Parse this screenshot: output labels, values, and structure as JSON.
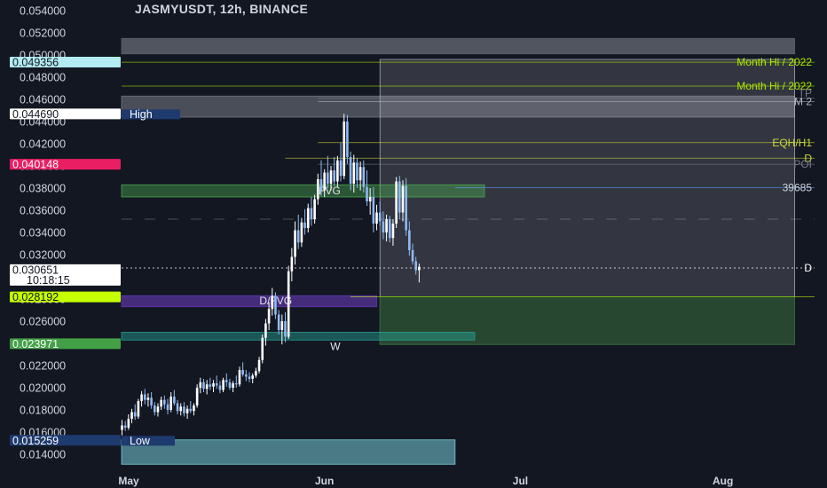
{
  "chart_data": {
    "type": "candlestick",
    "title": "JASMYUSDT, 12h, BINANCE",
    "ylim": [
      0.0125,
      0.0555
    ],
    "y_ticks": [
      "0.054000",
      "0.052000",
      "0.050000",
      "0.048000",
      "0.046000",
      "0.044000",
      "0.042000",
      "0.040000",
      "0.038000",
      "0.036000",
      "0.034000",
      "0.032000",
      "0.030000",
      "0.028000",
      "0.026000",
      "0.024000",
      "0.022000",
      "0.020000",
      "0.018000",
      "0.016000",
      "0.014000"
    ],
    "x_ticks": [
      {
        "label": "May",
        "index": 0
      },
      {
        "label": "Jun",
        "index": 62
      },
      {
        "label": "Jul",
        "index": 122
      },
      {
        "label": "Aug",
        "index": 184
      }
    ],
    "price_tags": [
      {
        "value": 0.049356,
        "text": "0.049356",
        "bg": "#b2ebf2",
        "fg": "#131722"
      },
      {
        "value": 0.04469,
        "text": "0.044690",
        "bg": "#ffffff",
        "fg": "#131722",
        "side_text": "High",
        "side_bg": "#1e3a6e"
      },
      {
        "value": 0.040148,
        "text": "0.040148",
        "bg": "#e91e63",
        "fg": "#ffffff"
      },
      {
        "value": 0.030651,
        "text": "0.030651",
        "sub": "10:18:15",
        "bg": "#ffffff",
        "fg": "#131722"
      },
      {
        "value": 0.028192,
        "text": "0.028192",
        "bg": "#c6ff00",
        "fg": "#131722"
      },
      {
        "value": 0.023971,
        "text": "0.023971",
        "bg": "#43a047",
        "fg": "#ffffff"
      },
      {
        "value": 0.015259,
        "text": "0.015259",
        "bg": "#1e3a6e",
        "fg": "#ffffff",
        "side_text": "Low",
        "side_bg": "#1e3a6e"
      }
    ],
    "levels": [
      {
        "value": 0.04935,
        "from": 0,
        "text": "Month Hi / 2022",
        "color": "#aeea00"
      },
      {
        "value": 0.0472,
        "from": 0,
        "text": "Month Hi / 2022",
        "color": "#aeea00"
      },
      {
        "value": 0.0461,
        "from": 60,
        "text": "TP",
        "color": "#787b86"
      },
      {
        "value": 0.0458,
        "from": 60,
        "text": "M 2",
        "color": "#b2b5be"
      },
      {
        "value": 0.0421,
        "from": 60,
        "text": "EQH/H1",
        "color": "#cddc39"
      },
      {
        "value": 0.0407,
        "from": 50,
        "text": "D",
        "color": "#cddc39"
      },
      {
        "value": 0.04015,
        "from": 60,
        "text": "POI",
        "color": "#787b86"
      },
      {
        "value": 0.03805,
        "from": 102,
        "text": "39685",
        "color": "#5b9cf6"
      },
      {
        "value": 0.0308,
        "from": 0,
        "text": "D",
        "color": "#ffffff"
      },
      {
        "value": 0.0282,
        "from": 70,
        "text": "",
        "color": "#c6ff00"
      }
    ],
    "zones": [
      {
        "top": 0.0515,
        "bottom": 0.0501,
        "from": 0,
        "to": 206,
        "color": "#5d606b",
        "opacity": 0.85,
        "text": ""
      },
      {
        "top": 0.0463,
        "bottom": 0.0444,
        "from": 0,
        "to": 206,
        "color": "#787b86",
        "opacity": 0.55,
        "text": ""
      },
      {
        "top": 0.0496,
        "bottom": 0.0239,
        "from": 79,
        "to": 206,
        "color": "#b2b5be",
        "opacity": 0.2,
        "text": ""
      },
      {
        "top": 0.0282,
        "bottom": 0.0239,
        "from": 79,
        "to": 206,
        "color": "#1b5e20",
        "opacity": 0.45,
        "text": ""
      },
      {
        "top": 0.0383,
        "bottom": 0.0372,
        "from": 0,
        "to": 111,
        "color": "#4caf50",
        "opacity": 0.42,
        "text": "FVG"
      },
      {
        "top": 0.0283,
        "bottom": 0.0273,
        "from": 0,
        "to": 78,
        "color": "#673ab7",
        "opacity": 0.6,
        "text": "D/FVG"
      },
      {
        "top": 0.025,
        "bottom": 0.0243,
        "from": 0,
        "to": 108,
        "color": "#26a69a",
        "opacity": 0.45,
        "text": "W"
      },
      {
        "top": 0.0153,
        "bottom": 0.0131,
        "from": 0,
        "to": 102,
        "color": "#80deea",
        "opacity": 0.5,
        "text": ""
      }
    ],
    "candles": [
      [
        0.0162,
        0.0171,
        0.0157,
        0.0166
      ],
      [
        0.0166,
        0.017,
        0.0161,
        0.0164
      ],
      [
        0.0164,
        0.0176,
        0.0162,
        0.0172
      ],
      [
        0.0172,
        0.0181,
        0.0168,
        0.0178
      ],
      [
        0.0178,
        0.0185,
        0.0171,
        0.0174
      ],
      [
        0.0174,
        0.019,
        0.0172,
        0.0188
      ],
      [
        0.0188,
        0.0197,
        0.0183,
        0.0194
      ],
      [
        0.0194,
        0.0199,
        0.0185,
        0.0189
      ],
      [
        0.0189,
        0.0195,
        0.0183,
        0.0191
      ],
      [
        0.0191,
        0.0196,
        0.0181,
        0.0184
      ],
      [
        0.0184,
        0.0187,
        0.0175,
        0.0178
      ],
      [
        0.0178,
        0.0186,
        0.0174,
        0.0183
      ],
      [
        0.0183,
        0.0192,
        0.018,
        0.0189
      ],
      [
        0.0189,
        0.0193,
        0.0181,
        0.0185
      ],
      [
        0.0185,
        0.019,
        0.0176,
        0.018
      ],
      [
        0.018,
        0.0196,
        0.0178,
        0.0192
      ],
      [
        0.0192,
        0.0198,
        0.0184,
        0.0186
      ],
      [
        0.0186,
        0.0189,
        0.0176,
        0.0179
      ],
      [
        0.0179,
        0.0186,
        0.0175,
        0.0183
      ],
      [
        0.0183,
        0.0187,
        0.0174,
        0.0177
      ],
      [
        0.0177,
        0.0184,
        0.0172,
        0.0181
      ],
      [
        0.0181,
        0.0188,
        0.0177,
        0.0179
      ],
      [
        0.0179,
        0.0186,
        0.0175,
        0.0184
      ],
      [
        0.0184,
        0.0203,
        0.0182,
        0.02
      ],
      [
        0.02,
        0.0209,
        0.0195,
        0.0205
      ],
      [
        0.0205,
        0.0208,
        0.0196,
        0.0199
      ],
      [
        0.0199,
        0.0207,
        0.0194,
        0.0203
      ],
      [
        0.0203,
        0.0209,
        0.0198,
        0.0201
      ],
      [
        0.0201,
        0.0207,
        0.0196,
        0.0204
      ],
      [
        0.0204,
        0.0211,
        0.0199,
        0.0202
      ],
      [
        0.0202,
        0.0206,
        0.0195,
        0.0198
      ],
      [
        0.0198,
        0.0209,
        0.0196,
        0.0207
      ],
      [
        0.0207,
        0.0213,
        0.0201,
        0.0205
      ],
      [
        0.0205,
        0.0208,
        0.0198,
        0.02
      ],
      [
        0.02,
        0.0206,
        0.0196,
        0.0204
      ],
      [
        0.0204,
        0.0211,
        0.02,
        0.0203
      ],
      [
        0.0203,
        0.0219,
        0.0201,
        0.0216
      ],
      [
        0.0216,
        0.0223,
        0.021,
        0.0212
      ],
      [
        0.0212,
        0.0216,
        0.0206,
        0.021
      ],
      [
        0.021,
        0.0214,
        0.0205,
        0.0208
      ],
      [
        0.0208,
        0.0213,
        0.0204,
        0.0211
      ],
      [
        0.0211,
        0.0218,
        0.0209,
        0.0215
      ],
      [
        0.0215,
        0.0228,
        0.0213,
        0.0225
      ],
      [
        0.0225,
        0.0248,
        0.0222,
        0.0245
      ],
      [
        0.0245,
        0.0262,
        0.0238,
        0.0258
      ],
      [
        0.0258,
        0.0277,
        0.0252,
        0.0271
      ],
      [
        0.0271,
        0.029,
        0.0265,
        0.0283
      ],
      [
        0.0283,
        0.0286,
        0.0262,
        0.0266
      ],
      [
        0.0266,
        0.027,
        0.0248,
        0.0252
      ],
      [
        0.0252,
        0.0266,
        0.0239,
        0.026
      ],
      [
        0.026,
        0.0268,
        0.0241,
        0.0246
      ],
      [
        0.0246,
        0.031,
        0.0244,
        0.0305
      ],
      [
        0.0305,
        0.0326,
        0.0296,
        0.0318
      ],
      [
        0.0318,
        0.035,
        0.0311,
        0.0342
      ],
      [
        0.0342,
        0.0356,
        0.0325,
        0.0331
      ],
      [
        0.0331,
        0.0353,
        0.0327,
        0.0349
      ],
      [
        0.0349,
        0.0361,
        0.0338,
        0.0344
      ],
      [
        0.0344,
        0.0366,
        0.034,
        0.0362
      ],
      [
        0.0362,
        0.0372,
        0.0346,
        0.0352
      ],
      [
        0.0352,
        0.0374,
        0.0348,
        0.037
      ],
      [
        0.037,
        0.0393,
        0.0365,
        0.0388
      ],
      [
        0.0388,
        0.0405,
        0.0373,
        0.0378
      ],
      [
        0.0378,
        0.0397,
        0.0372,
        0.0394
      ],
      [
        0.0394,
        0.0409,
        0.038,
        0.0384
      ],
      [
        0.0384,
        0.04,
        0.0378,
        0.0396
      ],
      [
        0.0396,
        0.0408,
        0.0382,
        0.0386
      ],
      [
        0.0386,
        0.0409,
        0.0381,
        0.0405
      ],
      [
        0.0405,
        0.0421,
        0.0386,
        0.0391
      ],
      [
        0.0391,
        0.0447,
        0.0388,
        0.044
      ],
      [
        0.044,
        0.0446,
        0.0402,
        0.0408
      ],
      [
        0.0408,
        0.0413,
        0.0378,
        0.0384
      ],
      [
        0.0384,
        0.041,
        0.0376,
        0.0403
      ],
      [
        0.0403,
        0.0407,
        0.038,
        0.0387
      ],
      [
        0.0387,
        0.0404,
        0.0378,
        0.0399
      ],
      [
        0.0399,
        0.0405,
        0.0376,
        0.0381
      ],
      [
        0.0381,
        0.0396,
        0.0364,
        0.0368
      ],
      [
        0.0368,
        0.038,
        0.0356,
        0.0372
      ],
      [
        0.0372,
        0.0381,
        0.034,
        0.0348
      ],
      [
        0.0348,
        0.0365,
        0.0342,
        0.0358
      ],
      [
        0.0358,
        0.0368,
        0.0346,
        0.035
      ],
      [
        0.035,
        0.0359,
        0.0334,
        0.034
      ],
      [
        0.034,
        0.0356,
        0.0332,
        0.0352
      ],
      [
        0.0352,
        0.0355,
        0.0331,
        0.0335
      ],
      [
        0.0335,
        0.0352,
        0.0328,
        0.0348
      ],
      [
        0.0348,
        0.039,
        0.0344,
        0.0386
      ],
      [
        0.0386,
        0.0391,
        0.0352,
        0.0358
      ],
      [
        0.0358,
        0.0387,
        0.035,
        0.0382
      ],
      [
        0.0382,
        0.0389,
        0.0337,
        0.0342
      ],
      [
        0.0342,
        0.035,
        0.0319,
        0.0324
      ],
      [
        0.0324,
        0.033,
        0.0311,
        0.0314
      ],
      [
        0.0314,
        0.0318,
        0.0302,
        0.0306
      ],
      [
        0.0306,
        0.0312,
        0.0295,
        0.0309
      ]
    ]
  }
}
